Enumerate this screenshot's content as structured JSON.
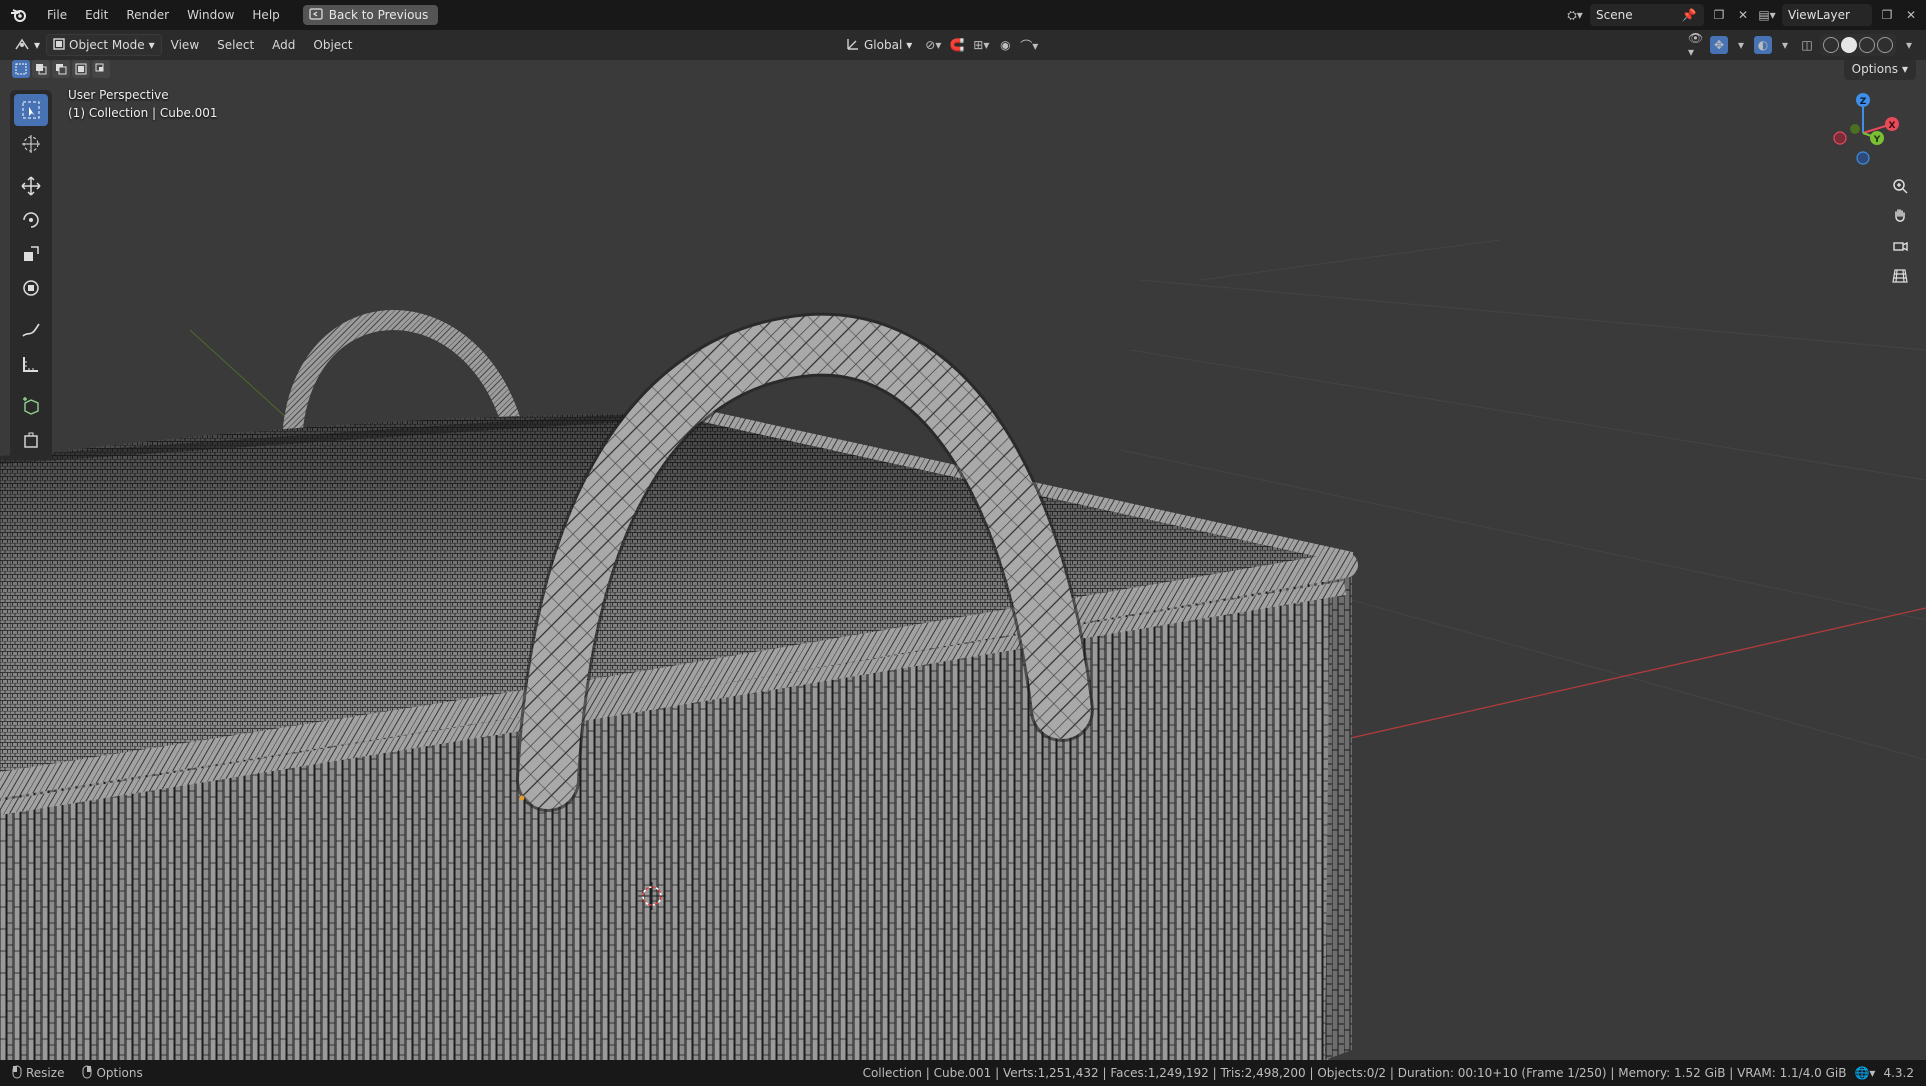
{
  "menu": {
    "items": [
      "File",
      "Edit",
      "Render",
      "Window",
      "Help"
    ],
    "back_button": "Back to Previous"
  },
  "top_right": {
    "scene": "Scene",
    "view_layer": "ViewLayer"
  },
  "viewport_header": {
    "mode": "Object Mode",
    "menus": [
      "View",
      "Select",
      "Add",
      "Object"
    ],
    "transform_orientation": "Global",
    "options": "Options"
  },
  "viewport": {
    "perspective": "User Perspective",
    "collection_info": "(1) Collection | Cube.001"
  },
  "gizmo": {
    "z": "Z",
    "y": "Y",
    "x": "X",
    "colors": {
      "x": "#e94a5a",
      "y": "#7bbf35",
      "z": "#3f8fe8"
    }
  },
  "status": {
    "left": [
      "Resize",
      "Options"
    ],
    "stats": "Collection | Cube.001 | Verts:1,251,432 | Faces:1,249,192 | Tris:2,498,200 | Objects:0/2 | Duration: 00:10+10 (Frame 1/250) | Memory: 1.52 GiB | VRAM: 1.1/4.0 GiB",
    "version": "4.3.2"
  },
  "tools": [
    "select-box",
    "cursor",
    "move",
    "rotate",
    "scale",
    "transform",
    "annotate",
    "measure",
    "add-cube",
    "add-object"
  ]
}
